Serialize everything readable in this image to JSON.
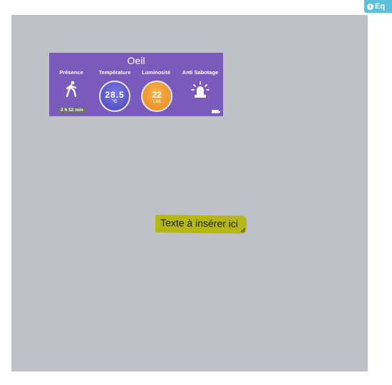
{
  "top_button": {
    "icon": "plus-circle-icon",
    "label": "Eq"
  },
  "widget": {
    "title": "Oeil",
    "background": "#7a5bbd",
    "commands": [
      {
        "label": "Présence",
        "icon": "walking-person-icon",
        "duration": "2 h 52 min"
      },
      {
        "label": "Température",
        "value": "28.5",
        "unit": "°C",
        "color": "#5a54cc"
      },
      {
        "label": "Luminosité",
        "value": "22",
        "unit": "Lux",
        "color": "#f0a034"
      },
      {
        "label": "Anti Sabotage",
        "icon": "alarm-siren-icon"
      }
    ],
    "battery_icon": "battery-icon"
  },
  "text_widget": {
    "text": "Texte à insérer ici",
    "background": "#b6b716"
  },
  "design_area": {
    "background": "#bec2c6"
  }
}
